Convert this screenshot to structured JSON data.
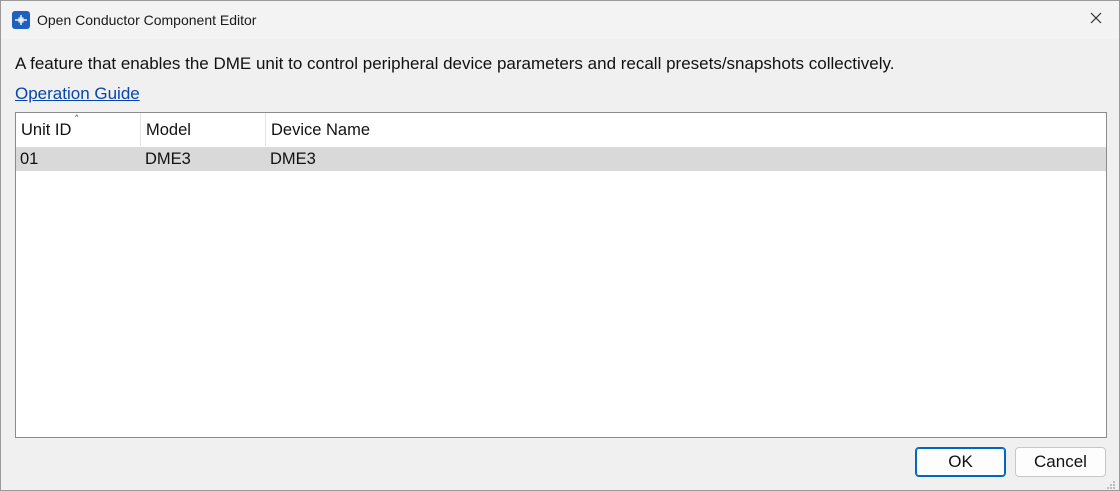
{
  "window": {
    "title": "Open Conductor Component Editor",
    "icon": "app-icon",
    "close_icon": "close-icon"
  },
  "main": {
    "description": "A feature that enables the DME unit to control peripheral device parameters and recall presets/snapshots collectively.",
    "guide_link": "Operation Guide"
  },
  "table": {
    "columns": [
      "Unit ID",
      "Model",
      "Device Name"
    ],
    "sort_column": "Unit ID",
    "sort_direction": "ascending",
    "rows": [
      [
        "01",
        "DME3",
        "DME3"
      ]
    ]
  },
  "buttons": {
    "ok": "OK",
    "cancel": "Cancel"
  },
  "colors": {
    "accent": "#0067c0",
    "link": "#0645ad",
    "selected_row": "#d9d9d9",
    "app_icon": "#1f5fbf"
  }
}
